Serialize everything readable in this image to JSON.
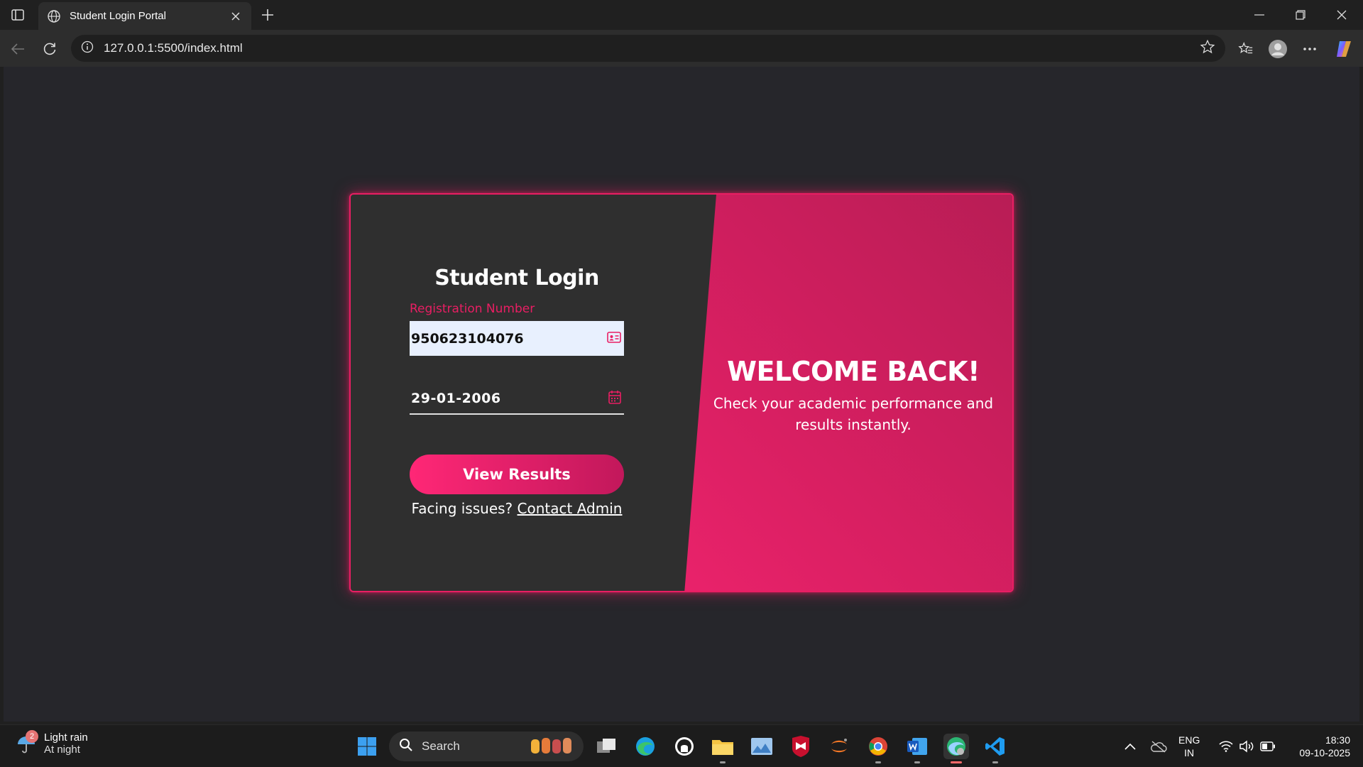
{
  "browser": {
    "tab_title": "Student Login Portal",
    "url": "127.0.0.1:5500/index.html"
  },
  "login": {
    "title": "Student Login",
    "reg_label": "Registration Number",
    "reg_value": "950623104076",
    "dob_value": "29-01-2006",
    "submit_label": "View Results",
    "help_text": "Facing issues?",
    "help_link": "Contact Admin"
  },
  "welcome": {
    "heading": "WELCOME BACK!",
    "text": "Check your academic performance and results instantly."
  },
  "colors": {
    "accent": "#e91e63",
    "page_bg": "#26262b",
    "card_left": "#2f2f2f"
  },
  "taskbar": {
    "weather_badge": "2",
    "weather_line1": "Light rain",
    "weather_line2": "At night",
    "search_placeholder": "Search",
    "lang_line1": "ENG",
    "lang_line2": "IN",
    "time": "18:30",
    "date": "09-10-2025"
  }
}
